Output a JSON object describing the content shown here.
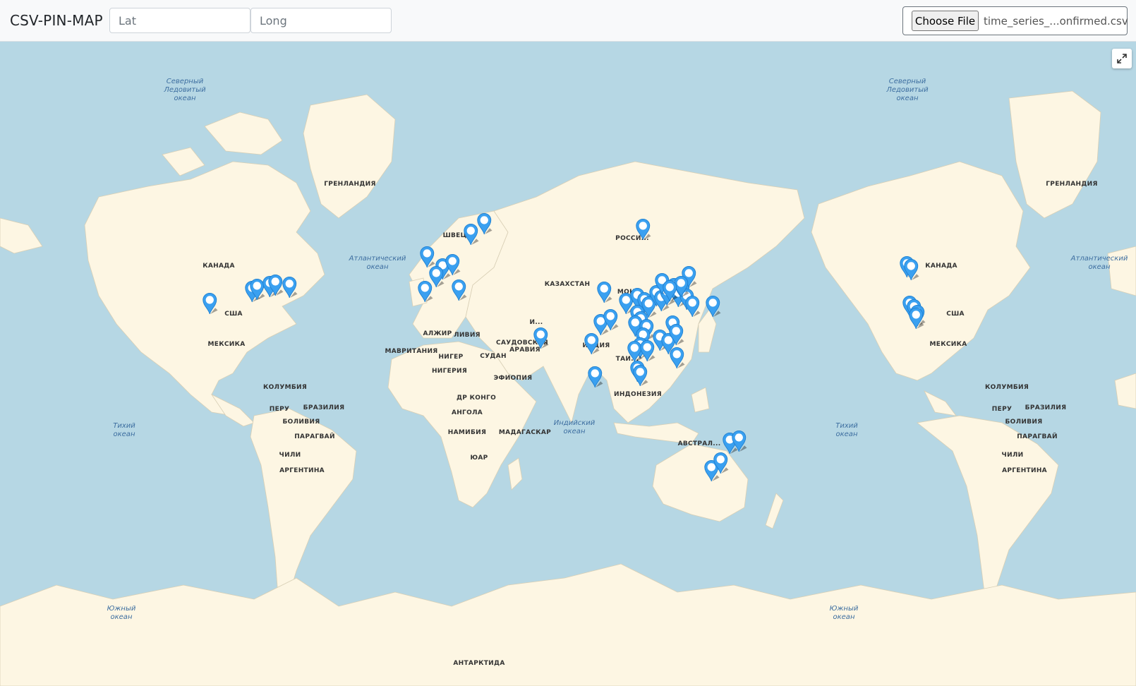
{
  "app": {
    "title": "CSV-PIN-MAP"
  },
  "inputs": {
    "lat_placeholder": "Lat",
    "long_placeholder": "Long"
  },
  "file": {
    "button_label": "Choose File",
    "file_name": "time_series_...onfirmed.csv"
  },
  "map": {
    "fullscreen_icon": "expand-icon",
    "pin_color": "#3aa0f0",
    "ocean_labels": [
      {
        "id": "arctic-1",
        "text": "Северный\nЛедовитый\nокеан"
      },
      {
        "id": "arctic-2",
        "text": "Северный\nЛедовитый\nокеан"
      },
      {
        "id": "atlantic-1",
        "text": "Атлантический\nокеан"
      },
      {
        "id": "atlantic-2",
        "text": "Атлантический\nокеан"
      },
      {
        "id": "pacific-1",
        "text": "Тихий\nокеан"
      },
      {
        "id": "pacific-2",
        "text": "Тихий\nокеан"
      },
      {
        "id": "indian",
        "text": "Индийский\nокеан"
      },
      {
        "id": "southern-1",
        "text": "Южный\nокеан"
      },
      {
        "id": "southern-2",
        "text": "Южный\nокеан"
      }
    ],
    "country_labels": [
      {
        "id": "greenland-1",
        "text": "ГРЕНЛАНДИЯ"
      },
      {
        "id": "greenland-2",
        "text": "ГРЕНЛАНДИЯ"
      },
      {
        "id": "canada-1",
        "text": "КАНАДА"
      },
      {
        "id": "canada-2",
        "text": "КАНАДА"
      },
      {
        "id": "usa-1",
        "text": "США"
      },
      {
        "id": "usa-2",
        "text": "США"
      },
      {
        "id": "mexico-1",
        "text": "МЕКСИКА"
      },
      {
        "id": "mexico-2",
        "text": "МЕКСИКА"
      },
      {
        "id": "colombia-1",
        "text": "КОЛУМБИЯ"
      },
      {
        "id": "colombia-2",
        "text": "КОЛУМБИЯ"
      },
      {
        "id": "peru-1",
        "text": "ПЕРУ"
      },
      {
        "id": "peru-2",
        "text": "ПЕРУ"
      },
      {
        "id": "brazil-1",
        "text": "БРАЗИЛИЯ"
      },
      {
        "id": "brazil-2",
        "text": "БРАЗИЛИЯ"
      },
      {
        "id": "bolivia-1",
        "text": "БОЛИВИЯ"
      },
      {
        "id": "bolivia-2",
        "text": "БОЛИВИЯ"
      },
      {
        "id": "paraguay-1",
        "text": "ПАРАГВАЙ"
      },
      {
        "id": "paraguay-2",
        "text": "ПАРАГВАЙ"
      },
      {
        "id": "chile-1",
        "text": "ЧИЛИ"
      },
      {
        "id": "chile-2",
        "text": "ЧИЛИ"
      },
      {
        "id": "argentina-1",
        "text": "АРГЕНТИНА"
      },
      {
        "id": "argentina-2",
        "text": "АРГЕНТИНА"
      },
      {
        "id": "sweden",
        "text": "ШВЕЦ..."
      },
      {
        "id": "russia",
        "text": "РОССИ..."
      },
      {
        "id": "kazakhstan",
        "text": "КАЗАХСТАН"
      },
      {
        "id": "algeria",
        "text": "АЛЖИР"
      },
      {
        "id": "libya",
        "text": "ЛИВИЯ"
      },
      {
        "id": "mauritania",
        "text": "МАВРИТАНИЯ"
      },
      {
        "id": "niger",
        "text": "НИГЕР"
      },
      {
        "id": "sudan",
        "text": "СУДАН"
      },
      {
        "id": "saudi-1",
        "text": "САУДОВСКАЯ"
      },
      {
        "id": "saudi-2",
        "text": "АРАВИЯ"
      },
      {
        "id": "nigeria",
        "text": "НИГЕРИЯ"
      },
      {
        "id": "ethiopia",
        "text": "ЭФИОПИЯ"
      },
      {
        "id": "drc",
        "text": "ДР КОНГО"
      },
      {
        "id": "angola",
        "text": "АНГОЛА"
      },
      {
        "id": "namibia",
        "text": "НАМИБИЯ"
      },
      {
        "id": "madagascar",
        "text": "МАДАГАСКАР"
      },
      {
        "id": "sa",
        "text": "ЮАР"
      },
      {
        "id": "india",
        "text": "ИНДИЯ"
      },
      {
        "id": "indonesia",
        "text": "ИНДОНЕЗИЯ"
      },
      {
        "id": "australia",
        "text": "АВСТРАЛ..."
      },
      {
        "id": "antarctica",
        "text": "АНТАРКТИДА"
      },
      {
        "id": "thailand",
        "text": "ТАИ..."
      },
      {
        "id": "iran",
        "text": "И..."
      },
      {
        "id": "mongolia",
        "text": "МОНГ..."
      }
    ],
    "pin_count": 62
  }
}
